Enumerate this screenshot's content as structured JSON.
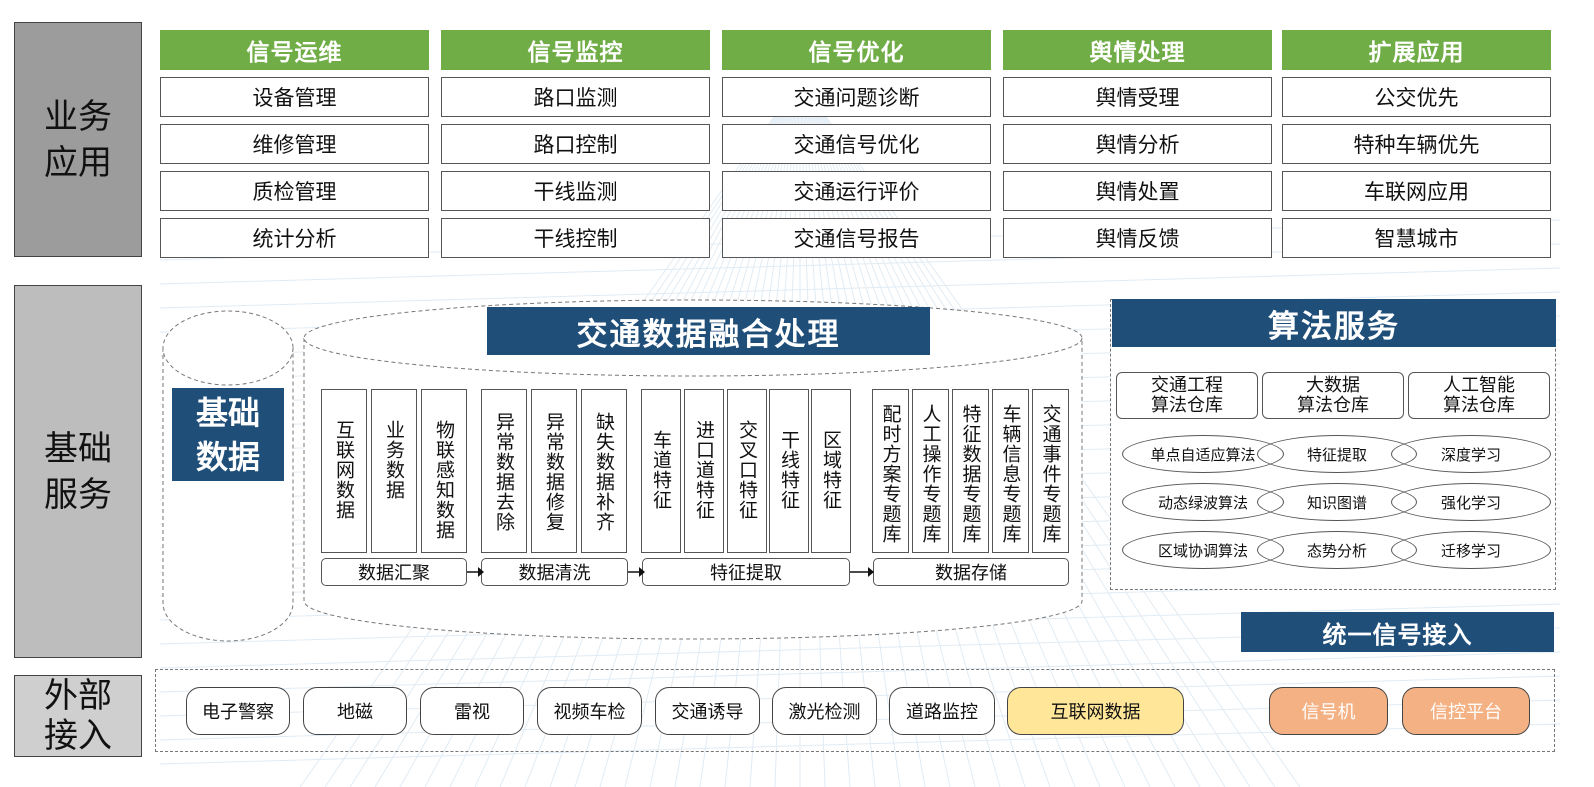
{
  "layers": {
    "business": [
      "业务",
      "应用"
    ],
    "base": [
      "基础",
      "服务"
    ],
    "external": [
      "外部",
      "接入"
    ]
  },
  "business_columns": [
    {
      "title": "信号运维",
      "items": [
        "设备管理",
        "维修管理",
        "质检管理",
        "统计分析"
      ]
    },
    {
      "title": "信号监控",
      "items": [
        "路口监测",
        "路口控制",
        "干线监测",
        "干线控制"
      ]
    },
    {
      "title": "信号优化",
      "items": [
        "交通问题诊断",
        "交通信号优化",
        "交通运行评价",
        "交通信号报告"
      ]
    },
    {
      "title": "舆情处理",
      "items": [
        "舆情受理",
        "舆情分析",
        "舆情处置",
        "舆情反馈"
      ]
    },
    {
      "title": "扩展应用",
      "items": [
        "公交优先",
        "特种车辆优先",
        "车联网应用",
        "智慧城市"
      ]
    }
  ],
  "base_data": {
    "lines": [
      "基础",
      "数据"
    ]
  },
  "fusion": {
    "title": "交通数据融合处理",
    "groups": [
      {
        "stage": "数据汇聚",
        "items": [
          "互联网数据",
          "业务数据",
          "物联感知数据"
        ]
      },
      {
        "stage": "数据清洗",
        "items": [
          "异常数据去除",
          "异常数据修复",
          "缺失数据补齐"
        ]
      },
      {
        "stage": "特征提取",
        "items": [
          "车道特征",
          "进口道特征",
          "交叉口特征",
          "干线特征",
          "区域特征"
        ]
      },
      {
        "stage": "数据存储",
        "items": [
          "配时方案专题库",
          "人工操作专题库",
          "特征数据专题库",
          "车辆信息专题库",
          "交通事件专题库"
        ]
      }
    ]
  },
  "algorithm": {
    "title": "算法服务",
    "libraries": [
      [
        "交通工程",
        "算法仓库"
      ],
      [
        "大数据",
        "算法仓库"
      ],
      [
        "人工智能",
        "算法仓库"
      ]
    ],
    "rows": [
      [
        "单点自适应算法",
        "特征提取",
        "深度学习"
      ],
      [
        "动态绿波算法",
        "知识图谱",
        "强化学习"
      ],
      [
        "区域协调算法",
        "态势分析",
        "迁移学习"
      ]
    ]
  },
  "unified_access": "统一信号接入",
  "external": {
    "sources": [
      "电子警察",
      "地磁",
      "雷视",
      "视频车检",
      "交通诱导",
      "激光检测",
      "道路监控"
    ],
    "internet": "互联网数据",
    "signal": [
      "信号机",
      "信控平台"
    ]
  },
  "colors": {
    "green_header": "#70ad47",
    "navy": "#1f4e79",
    "internet_fill": "#ffe699",
    "signal_fill": "#f4b183"
  }
}
